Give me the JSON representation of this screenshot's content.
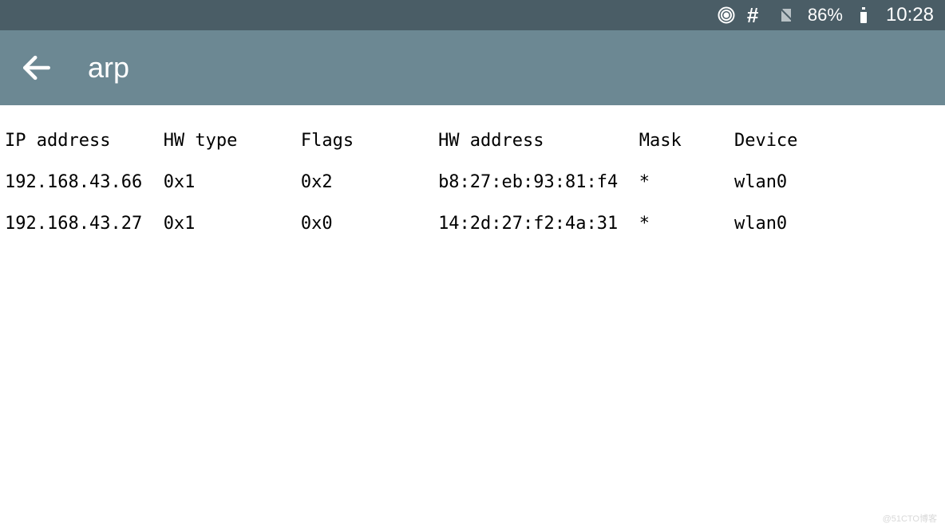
{
  "status_bar": {
    "battery_percent": "86%",
    "clock": "10:28",
    "hash": "#"
  },
  "app_bar": {
    "title": "arp"
  },
  "arp": {
    "headers": {
      "ip": "IP address",
      "hwtype": "HW type",
      "flags": "Flags",
      "hwaddr": "HW address",
      "mask": "Mask",
      "device": "Device"
    },
    "rows": [
      {
        "ip": "192.168.43.66",
        "hwtype": "0x1",
        "flags": "0x2",
        "hwaddr": "b8:27:eb:93:81:f4",
        "mask": "*",
        "device": "wlan0"
      },
      {
        "ip": "192.168.43.27",
        "hwtype": "0x1",
        "flags": "0x0",
        "hwaddr": "14:2d:27:f2:4a:31",
        "mask": "*",
        "device": "wlan0"
      }
    ]
  },
  "watermark": "@51CTO博客"
}
